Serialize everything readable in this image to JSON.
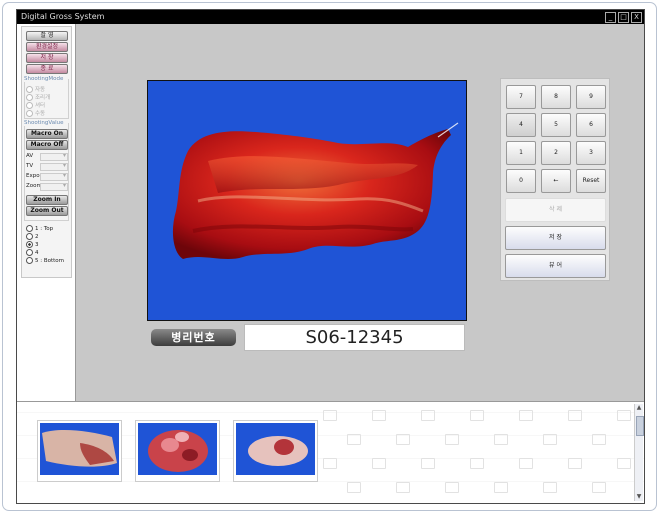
{
  "window": {
    "title": "Digital Gross System",
    "controls": {
      "minimize": "_",
      "maximize": "□",
      "close": "X"
    }
  },
  "sidebar": {
    "buttons": [
      {
        "label": "촬 영",
        "style": "gray"
      },
      {
        "label": "환경설정",
        "style": "pink"
      },
      {
        "label": "저 장",
        "style": "pink"
      },
      {
        "label": "종 료",
        "style": "pink"
      }
    ],
    "shooting_mode": {
      "title": "ShootingMode",
      "options": [
        "자동",
        "조리개",
        "셔터",
        "수동"
      ]
    },
    "shooting_value": {
      "title": "ShootingValue",
      "macro_on": "Macro On",
      "macro_off": "Macro Off",
      "fields": [
        "AV",
        "TV",
        "Expo",
        "Zoom"
      ],
      "zoom_in": "Zoom In",
      "zoom_out": "Zoom Out"
    },
    "view_options": [
      {
        "label": "1 : Top",
        "selected": false
      },
      {
        "label": "2",
        "selected": false
      },
      {
        "label": "3",
        "selected": true
      },
      {
        "label": "4",
        "selected": false
      },
      {
        "label": "5 : Bottom",
        "selected": false
      }
    ]
  },
  "main": {
    "specimen_label": "병리번호",
    "specimen_id": "S06-12345"
  },
  "keypad": {
    "keys": [
      "7",
      "8",
      "9",
      "4",
      "5",
      "6",
      "1",
      "2",
      "3",
      "0",
      "←",
      "Reset"
    ],
    "delete_button": "삭 제",
    "save_button": "저 장",
    "view_button": "뷰 어"
  },
  "thumbnails": {
    "count": 3
  },
  "colors": {
    "photo_background": "#1f54d6",
    "workspace": "#c8c8c8",
    "titlebar": "#000000"
  }
}
